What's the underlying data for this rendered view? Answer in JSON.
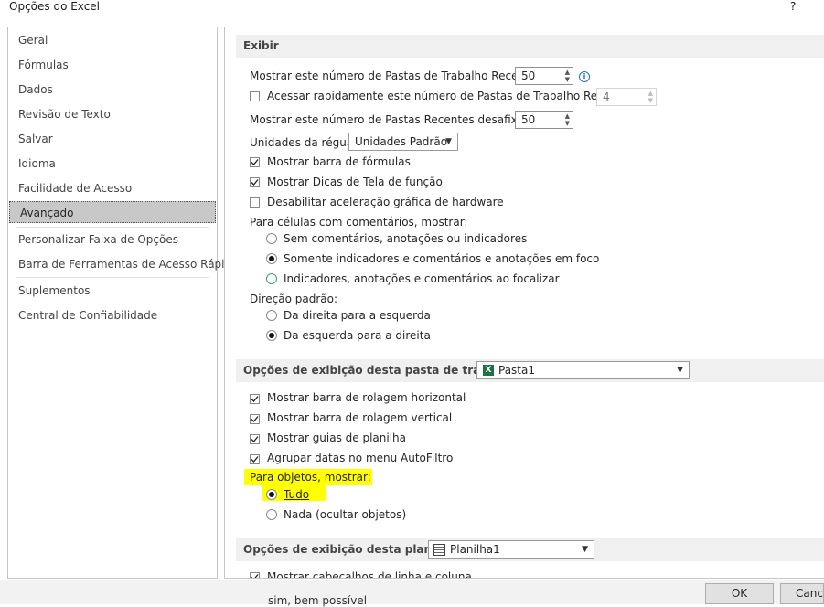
{
  "window": {
    "title": "Opções do Excel",
    "help": "?"
  },
  "sidebar": {
    "items": [
      {
        "label": "Geral"
      },
      {
        "label": "Fórmulas"
      },
      {
        "label": "Dados"
      },
      {
        "label": "Revisão de Texto"
      },
      {
        "label": "Salvar"
      },
      {
        "label": "Idioma"
      },
      {
        "label": "Facilidade de Acesso"
      },
      {
        "label": "Avançado"
      },
      {
        "label": "Personalizar Faixa de Opções"
      },
      {
        "label": "Barra de Ferramentas de Acesso Rápido"
      },
      {
        "label": "Suplementos"
      },
      {
        "label": "Central de Confiabilidade"
      }
    ],
    "selected": "Avançado"
  },
  "exibir": {
    "header": "Exibir",
    "recent_workbooks_label": "Mostrar este número de Pastas de Trabalho Recentes:",
    "recent_workbooks_value": "50",
    "quick_access_label": "Acessar rapidamente este número de Pastas de Trabalho Recentes:",
    "quick_access_value": "4",
    "unpinned_folders_label": "Mostrar este número de Pastas Recentes desafixadas:",
    "unpinned_folders_value": "50",
    "ruler_units_label": "Unidades da régua",
    "ruler_units_value": "Unidades Padrão",
    "show_formula_bar": "Mostrar barra de fórmulas",
    "show_function_tips": "Mostrar Dicas de Tela de função",
    "disable_hw_accel": "Desabilitar aceleração gráfica de hardware",
    "comments_label": "Para células com comentários, mostrar:",
    "comments_opt1": "Sem comentários, anotações ou indicadores",
    "comments_opt2": "Somente indicadores e comentários e anotações em foco",
    "comments_opt3": "Indicadores, anotações e comentários ao focalizar",
    "direction_label": "Direção padrão:",
    "direction_opt1": "Da direita para a esquerda",
    "direction_opt2": "Da esquerda para a direita"
  },
  "workbook": {
    "header": "Opções de exibição desta pasta de trabalho:",
    "selected": "Pasta1",
    "hscroll": "Mostrar barra de rolagem horizontal",
    "vscroll": "Mostrar barra de rolagem vertical",
    "sheet_tabs": "Mostrar guias de planilha",
    "group_dates": "Agrupar datas no menu AutoFiltro",
    "objects_label": "Para objetos, mostrar:",
    "objects_all": "Tudo",
    "objects_none": "Nada (ocultar objetos)"
  },
  "worksheet": {
    "header": "Opções de exibição desta planilha:",
    "selected": "Planilha1",
    "row_col_headers": "Mostrar cabeçalhos de linha e coluna"
  },
  "footer": {
    "ok": "OK",
    "cancel": "Canc"
  },
  "background_text": "sim, bem possível",
  "accent": {
    "highlight": "#ffff00",
    "selected_nav": "#c8c8c8",
    "excel_green": "#1e7145"
  }
}
